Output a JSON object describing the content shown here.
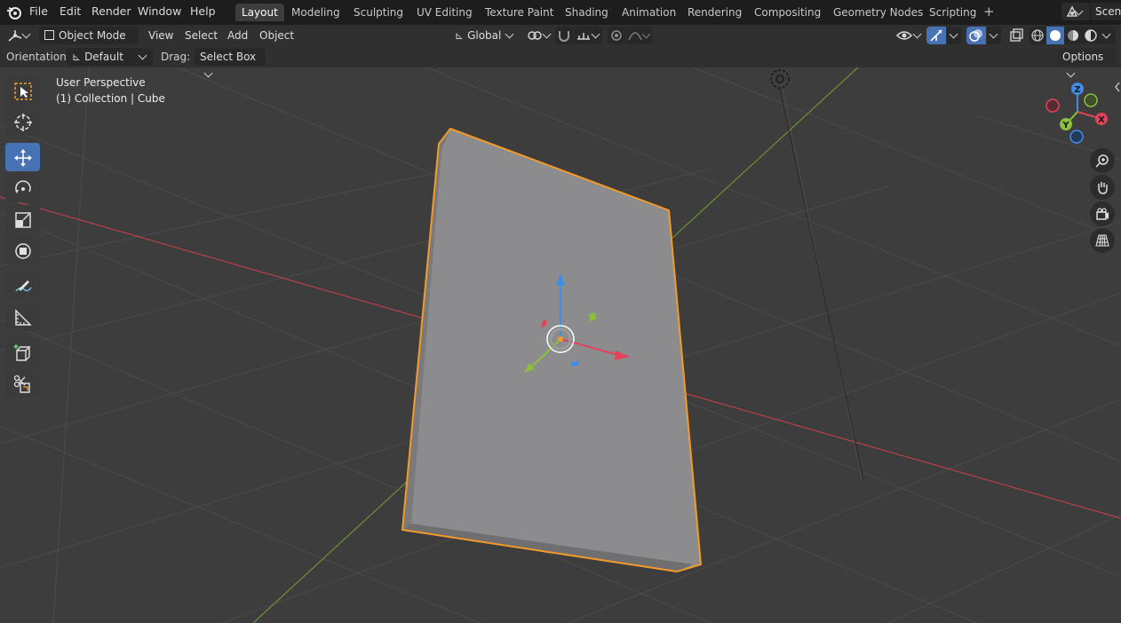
{
  "menubar": {
    "items": [
      "File",
      "Edit",
      "Render",
      "Window",
      "Help"
    ]
  },
  "workspaces": {
    "tabs": [
      "Layout",
      "Modeling",
      "Sculpting",
      "UV Editing",
      "Texture Paint",
      "Shading",
      "Animation",
      "Rendering",
      "Compositing",
      "Geometry Nodes",
      "Scripting"
    ],
    "active": "Layout",
    "scene_label": "Scene"
  },
  "header": {
    "mode": "Object Mode",
    "menus": [
      "View",
      "Select",
      "Add",
      "Object"
    ],
    "transform_orientation": "Global"
  },
  "tool_options": {
    "orientation_label": "Orientation:",
    "orientation_value": "Default",
    "drag_label": "Drag:",
    "drag_value": "Select Box",
    "options_label": "Options"
  },
  "viewport": {
    "perspective": "User Perspective",
    "collection_info": "(1) Collection | Cube"
  },
  "gizmo": {
    "x_label": "X",
    "y_label": "Y",
    "z_label": "Z",
    "x_color": "#e2425a",
    "y_color": "#8bbf3e",
    "z_color": "#3f8ee6"
  },
  "colors": {
    "selection_outline": "#f39a2a",
    "active_tool": "#4772b3",
    "x_axis_line": "#b9414b",
    "y_axis_line": "#6d9131"
  }
}
